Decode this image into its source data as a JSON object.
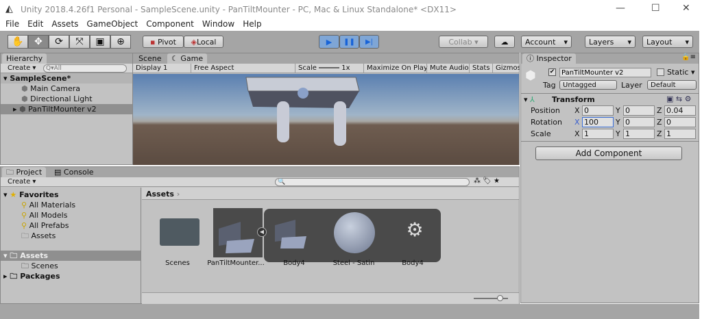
{
  "title": "Unity 2018.4.26f1 Personal - SampleScene.unity - PanTiltMounter - PC, Mac & Linux Standalone* <DX11>",
  "window_controls": {
    "min": "—",
    "max": "☐",
    "close": "✕"
  },
  "menu": [
    "File",
    "Edit",
    "Assets",
    "GameObject",
    "Component",
    "Window",
    "Help"
  ],
  "toolbar": {
    "tools": [
      "✋",
      "✥",
      "⟳",
      "⤧",
      "▣",
      "⊕"
    ],
    "pivot": "Pivot",
    "local": "Local",
    "play": "▶",
    "pause": "❚❚",
    "step": "▶|",
    "collab": "Collab ▾",
    "cloud": "☁",
    "account": "Account",
    "layers": "Layers",
    "layout": "Layout",
    "dropdown": "▾"
  },
  "hierarchy": {
    "tab": "Hierarchy",
    "create": "Create ▾",
    "search": "Q▾All",
    "scene": "SampleScene*",
    "items": [
      "Main Camera",
      "Directional Light",
      "PanTiltMounter v2"
    ]
  },
  "game": {
    "tabs": [
      "Scene",
      "Game"
    ],
    "display": "Display 1",
    "aspect": "Free Aspect",
    "scale_label": "Scale",
    "scale_value": "1x",
    "buttons": [
      "Maximize On Play",
      "Mute Audio",
      "Stats",
      "Gizmos"
    ]
  },
  "inspector": {
    "tab": "Inspector",
    "object_name": "PanTiltMounter v2",
    "static": "Static",
    "tag_label": "Tag",
    "tag": "Untagged",
    "layer_label": "Layer",
    "layer": "Default",
    "component": "Transform",
    "rows": [
      {
        "label": "Position",
        "x": "0",
        "y": "0",
        "z": "0.04"
      },
      {
        "label": "Rotation",
        "x": "100",
        "y": "0",
        "z": "0"
      },
      {
        "label": "Scale",
        "x": "1",
        "y": "1",
        "z": "1"
      }
    ],
    "axes": [
      "X",
      "Y",
      "Z"
    ],
    "add_component": "Add Component"
  },
  "project": {
    "tabs": [
      "Project",
      "Console"
    ],
    "create": "Create ▾",
    "favorites": "Favorites",
    "fav_items": [
      "All Materials",
      "All Models",
      "All Prefabs",
      "Assets"
    ],
    "assets": "Assets",
    "sub": [
      "Scenes"
    ],
    "packages": "Packages",
    "breadcrumb": "Assets",
    "grid": [
      "Scenes",
      "PanTiltMounter...",
      "Body4",
      "Steel - Satin",
      "Body4"
    ]
  }
}
